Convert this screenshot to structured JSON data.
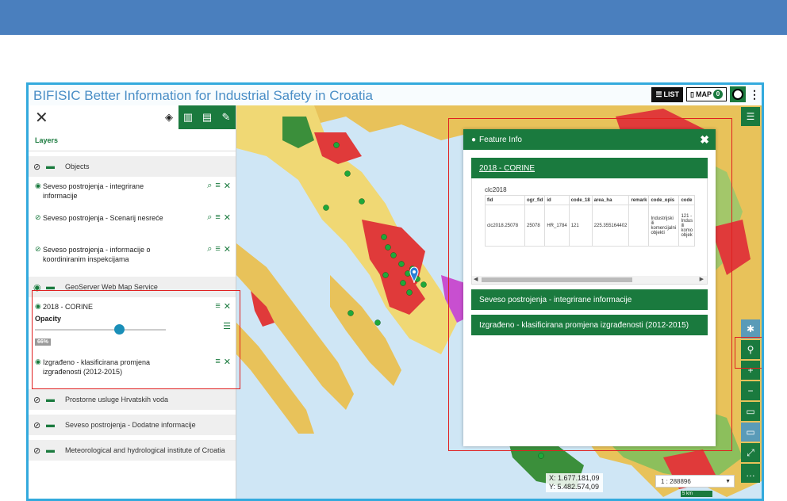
{
  "app": {
    "title": "BIFISIC Better Information for Industrial Safety in Croatia"
  },
  "topbar": {
    "list_label": "LIST",
    "map_label": "MAP",
    "map_count": "0"
  },
  "panel": {
    "tab_label": "Layers",
    "groups": [
      {
        "label": "Objects"
      },
      {
        "label": "GeoServer Web Map Service"
      },
      {
        "label": "Prostorne usluge Hrvatskih voda"
      },
      {
        "label": "Seveso postrojenja - Dodatne informacije"
      },
      {
        "label": "Meteorological and hydrological institute of Croatia"
      }
    ],
    "objects_layers": [
      {
        "label": "Seveso postrojenja - integrirane informacije"
      },
      {
        "label": "Seveso postrojenja - Scenarij nesreće"
      },
      {
        "label": "Seveso postrojenja - informacije o koordiniranim inspekcijama"
      }
    ],
    "wms_layers": [
      {
        "label": "2018 - CORINE"
      },
      {
        "label": "Izgrađeno - klasificirana promjena izgrađenosti (2012-2015)"
      }
    ],
    "opacity_label": "Opacity",
    "opacity_value": 0.66,
    "opacity_text": "66%"
  },
  "feature_info": {
    "title": "Feature Info",
    "tab": "2018 - CORINE",
    "table_name": "clc2018",
    "columns": [
      "fid",
      "ogr_fid",
      "id",
      "code_18",
      "area_ha",
      "remark",
      "code_opis",
      "code"
    ],
    "row": [
      "clc2018.25078",
      "25078",
      "HR_1784",
      "121",
      "225.355164402",
      "",
      "Industrijski ili komercijalni objekti",
      "121 - Indus ili komo objek"
    ],
    "sections": [
      "Seveso postrojenja - integrirane informacije",
      "Izgrađeno - klasificirana promjena izgrađenosti (2012-2015)"
    ]
  },
  "coords": {
    "x": "X: 1.677.181,09",
    "y": "Y: 5.482.574,09"
  },
  "scale": {
    "value": "1 : 288896",
    "bar": "5 km"
  },
  "colors": {
    "accent_green": "#1a7a3e",
    "frame_blue": "#33aadd",
    "topbar_blue": "#4a7fbe",
    "highlight_red": "#e02020"
  }
}
